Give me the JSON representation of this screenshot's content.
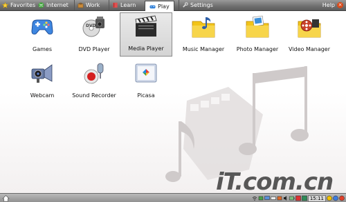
{
  "tabs": [
    {
      "label": "Favorites",
      "icon": "star-icon"
    },
    {
      "label": "Internet",
      "icon": "globe-icon"
    },
    {
      "label": "Work",
      "icon": "briefcase-icon"
    },
    {
      "label": "Learn",
      "icon": "book-icon"
    },
    {
      "label": "Play",
      "icon": "gamepad-icon",
      "active": true
    },
    {
      "label": "Settings",
      "icon": "wrench-icon"
    }
  ],
  "help": {
    "label": "Help"
  },
  "apps": [
    {
      "label": "Games",
      "icon": "gamepad-icon"
    },
    {
      "label": "DVD Player",
      "icon": "dvd-camera-icon"
    },
    {
      "label": "Media Player",
      "icon": "clapperboard-icon",
      "selected": true
    },
    {
      "label": "Music Manager",
      "icon": "music-folder-icon"
    },
    {
      "label": "Photo Manager",
      "icon": "photo-folder-icon"
    },
    {
      "label": "Video Manager",
      "icon": "video-folder-icon"
    },
    {
      "label": "Webcam",
      "icon": "webcam-icon"
    },
    {
      "label": "Sound Recorder",
      "icon": "microphone-icon"
    },
    {
      "label": "Picasa",
      "icon": "picasa-icon"
    }
  ],
  "taskbar": {
    "clock": "15:11"
  },
  "watermark": "iT.com.cn",
  "colors": {
    "tabbar": "#6f6f6f",
    "selected_bg": "#d4d4d4",
    "folder": "#f2c418"
  }
}
